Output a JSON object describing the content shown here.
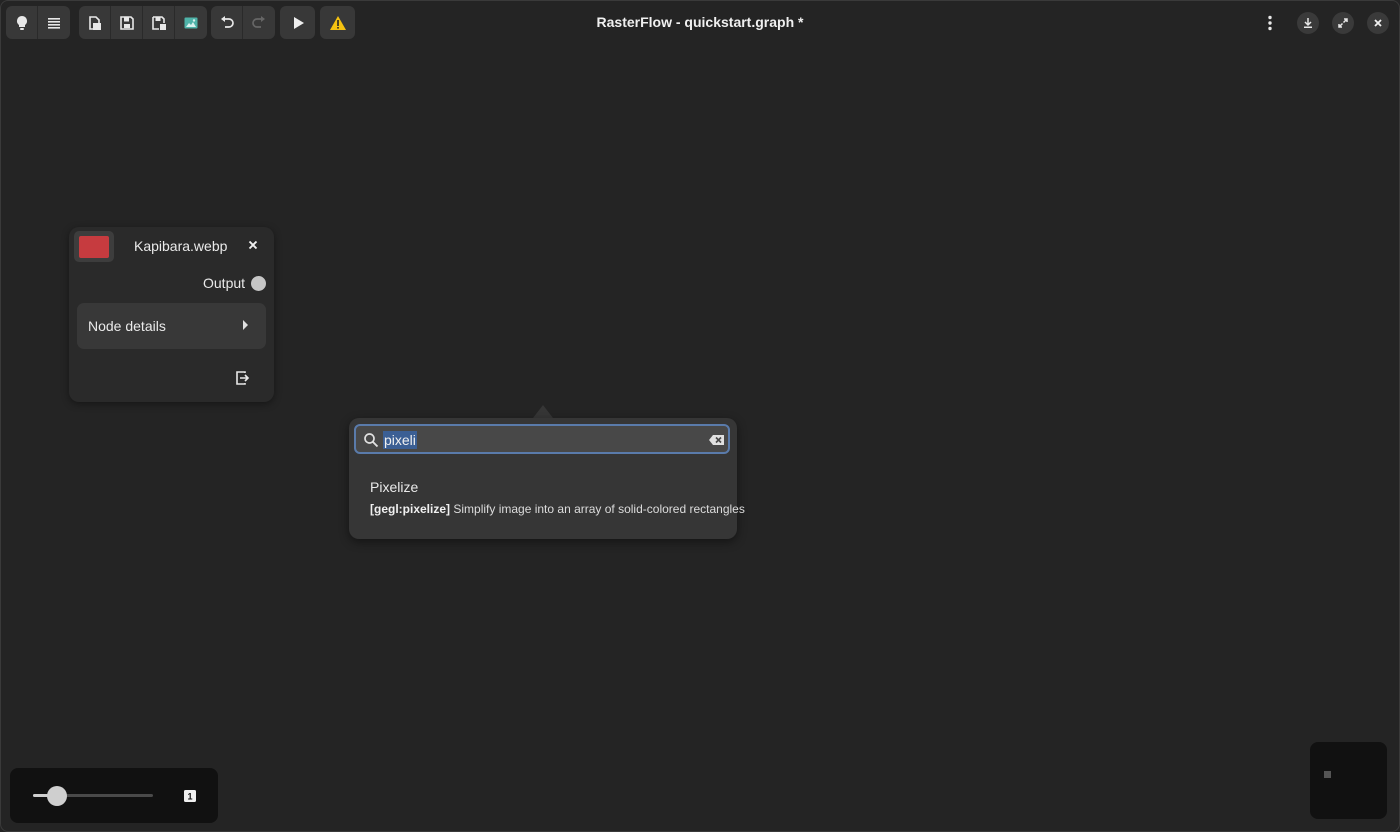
{
  "window": {
    "title": "RasterFlow - quickstart.graph *"
  },
  "toolbar": {
    "groups": [
      {
        "buttons": [
          "tips-icon",
          "menu-icon"
        ]
      },
      {
        "buttons": [
          "new-file-icon",
          "save-icon",
          "save-as-icon",
          "image-icon"
        ]
      },
      {
        "buttons": [
          "undo-icon",
          "redo-icon"
        ],
        "disabled": [
          "redo-icon"
        ]
      }
    ],
    "run_icon": "play-icon",
    "warning_icon": "warning-icon"
  },
  "window_controls": [
    "more-icon",
    "download-icon",
    "fullscreen-icon",
    "close-icon"
  ],
  "node": {
    "title": "Kapibara.webp",
    "thumbnail_color": "#c63b3f",
    "output_label": "Output",
    "details_label": "Node details"
  },
  "search": {
    "query": "pixeli",
    "results": [
      {
        "name": "Pixelize",
        "id": "[gegl:pixelize]",
        "description": "Simplify image into an array of solid-colored rectangles"
      }
    ]
  },
  "zoom": {
    "level": 0.2,
    "reset_label": "1"
  },
  "colors": {
    "accent": "#5a7bab",
    "selection": "#3b5f94",
    "warning": "#f5c211",
    "canvas": "#242424"
  }
}
